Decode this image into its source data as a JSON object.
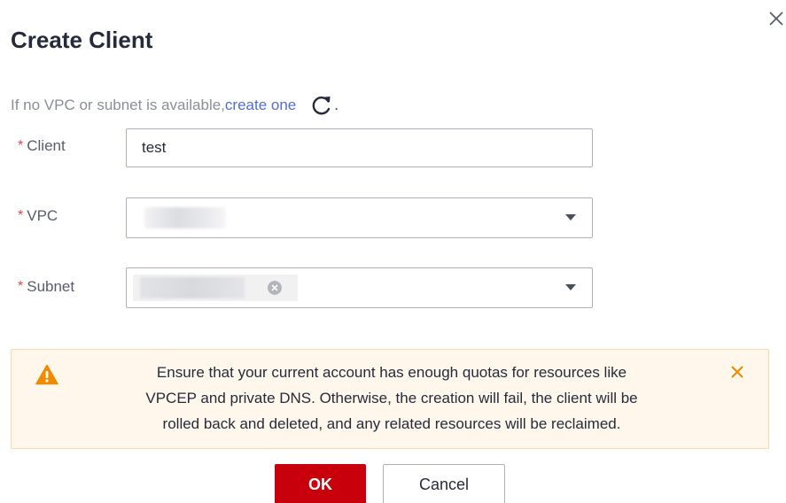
{
  "dialog": {
    "title": "Create Client",
    "close_icon": "close-icon"
  },
  "hint": {
    "prefix": "If no VPC or subnet is available,",
    "link": "create one",
    "suffix": ".",
    "refresh_icon": "refresh-icon"
  },
  "form": {
    "required_mark": "*",
    "client": {
      "label": "Client",
      "value": "test"
    },
    "vpc": {
      "label": "VPC",
      "selected_value_redacted": true
    },
    "subnet": {
      "label": "Subnet",
      "selected_tag_redacted": true,
      "tag_remove_icon": "clear-tag-icon"
    }
  },
  "alert": {
    "icon": "warning-icon",
    "line1": "Ensure that your current account has enough quotas for resources like",
    "line2": "VPCEP and private DNS. Otherwise, the creation will fail, the client will be",
    "line3": "rolled back and deleted, and any related resources will be reclaimed.",
    "close_icon": "close-icon"
  },
  "buttons": {
    "ok": "OK",
    "cancel": "Cancel"
  },
  "colors": {
    "primary": "#c7000b",
    "link": "#526ecc",
    "required": "#e54545",
    "warning": "#f08a00",
    "alert_bg": "#fff7eb"
  }
}
